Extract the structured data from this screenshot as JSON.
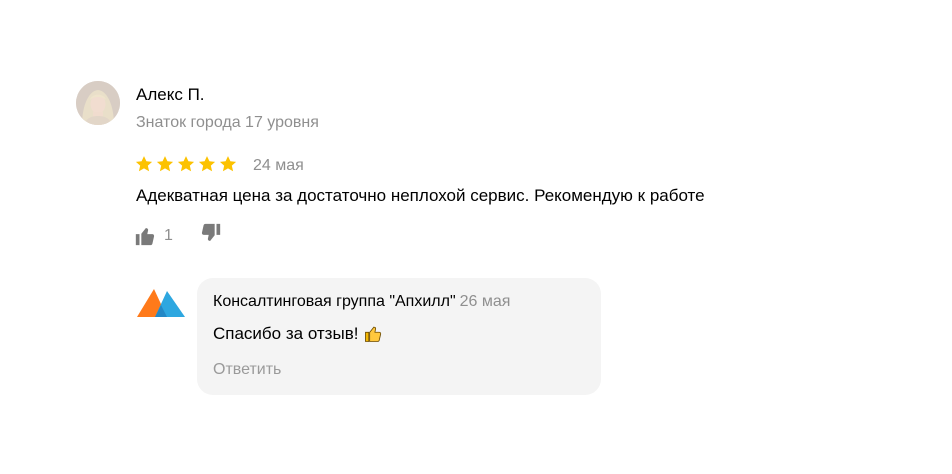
{
  "review": {
    "author_name": "Алекс П.",
    "author_status": "Знаток города 17 уровня",
    "rating": 5,
    "date": "24 мая",
    "text": "Адекватная цена за достаточно неплохой сервис. Рекомендую к работе",
    "likes": "1"
  },
  "reply": {
    "organization": "Консалтинговая группа \"Апхилл\"",
    "date": "26 мая",
    "text": "Спасибо за отзыв!",
    "action_label": "Ответить"
  },
  "colors": {
    "star": "#fcc200",
    "muted": "#8f8f8f",
    "bubble": "#f4f4f4",
    "logo_orange": "#ff7a1a",
    "logo_blue": "#2ea7e0"
  }
}
